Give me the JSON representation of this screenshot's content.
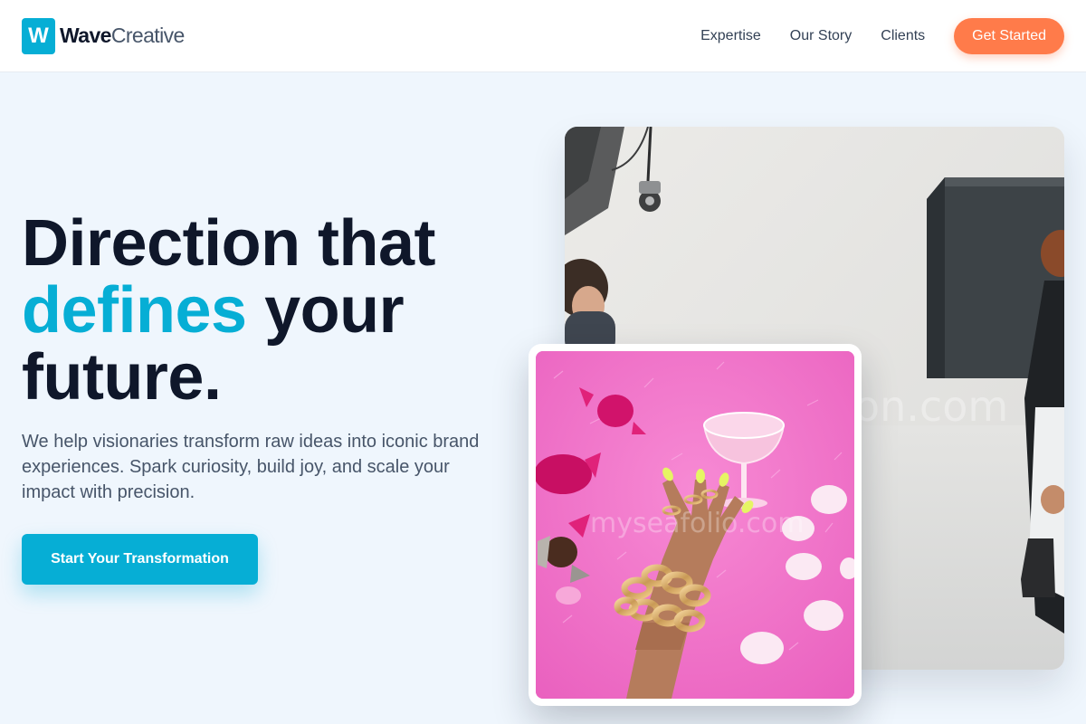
{
  "brand": {
    "mark": "W",
    "name_bold": "Wave",
    "name_light": "Creative"
  },
  "nav": {
    "items": [
      "Expertise",
      "Our Story",
      "Clients"
    ],
    "cta": "Get Started"
  },
  "hero": {
    "title_line1": "Direction that",
    "title_accent": "defines",
    "title_line2_rest": " your",
    "title_line3": "future.",
    "description": "We help visionaries transform raw ideas into iconic brand experiences. Spark curiosity, build joy, and scale your impact with precision.",
    "cta": "Start Your Transformation"
  },
  "colors": {
    "accent": "#06aed5",
    "cta_orange": "#ff7b4a",
    "background": "#eff6fd",
    "heading": "#0f172a"
  }
}
